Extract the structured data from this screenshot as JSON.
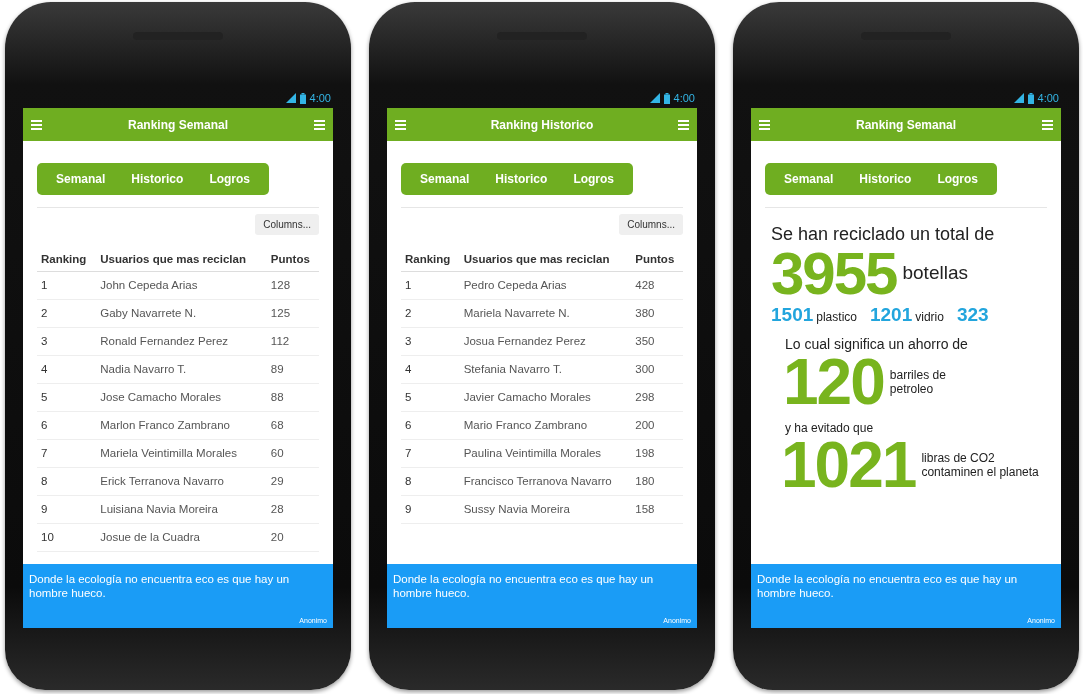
{
  "phones": [
    {
      "status": {
        "time": "4:00"
      },
      "title": "Ranking Semanal",
      "tabs": [
        "Semanal",
        "Historico",
        "Logros"
      ],
      "content": {
        "kind": "table",
        "columns_button": "Columns...",
        "columns": [
          "Ranking",
          "Usuarios que mas reciclan",
          "Puntos"
        ],
        "rows": [
          [
            "1",
            "John Cepeda Arias",
            "128"
          ],
          [
            "2",
            "Gaby Navarrete N.",
            "125"
          ],
          [
            "3",
            "Ronald Fernandez Perez",
            "112"
          ],
          [
            "4",
            "Nadia Navarro T.",
            "89"
          ],
          [
            "5",
            "Jose Camacho Morales",
            "88"
          ],
          [
            "6",
            "Marlon Franco Zambrano",
            "68"
          ],
          [
            "7",
            "Mariela Veintimilla Morales",
            "60"
          ],
          [
            "8",
            "Erick Terranova Navarro",
            "29"
          ],
          [
            "9",
            "Luisiana Navia Moreira",
            "28"
          ],
          [
            "10",
            "Josue de la Cuadra",
            "20"
          ]
        ]
      },
      "footer": {
        "quote": "Donde la ecología no encuentra eco es que hay un hombre hueco.",
        "author": "Anonimo"
      }
    },
    {
      "status": {
        "time": "4:00"
      },
      "title": "Ranking Historico",
      "tabs": [
        "Semanal",
        "Historico",
        "Logros"
      ],
      "content": {
        "kind": "table",
        "columns_button": "Columns...",
        "columns": [
          "Ranking",
          "Usuarios que mas reciclan",
          "Puntos"
        ],
        "rows": [
          [
            "1",
            "Pedro Cepeda Arias",
            "428"
          ],
          [
            "2",
            "Mariela Navarrete N.",
            "380"
          ],
          [
            "3",
            "Josua Fernandez Perez",
            "350"
          ],
          [
            "4",
            "Stefania Navarro T.",
            "300"
          ],
          [
            "5",
            "Javier Camacho Morales",
            "298"
          ],
          [
            "6",
            "Mario Franco Zambrano",
            "200"
          ],
          [
            "7",
            "Paulina Veintimilla Morales",
            "198"
          ],
          [
            "8",
            "Francisco Terranova Navarro",
            "180"
          ],
          [
            "9",
            "Sussy Navia Moreira",
            "158"
          ]
        ]
      },
      "footer": {
        "quote": "Donde la ecología no encuentra eco es que hay un hombre hueco.",
        "author": "Anonimo"
      }
    },
    {
      "status": {
        "time": "4:00"
      },
      "title": "Ranking Semanal",
      "tabs": [
        "Semanal",
        "Historico",
        "Logros"
      ],
      "content": {
        "kind": "stats",
        "total_label": "Se han reciclado un total de",
        "total": {
          "value": "3955",
          "unit": "botellas"
        },
        "breakdown": [
          {
            "kind": "count",
            "text": "1501"
          },
          {
            "kind": "label",
            "text": "plastico"
          },
          {
            "kind": "count",
            "text": "1201"
          },
          {
            "kind": "label",
            "text": "vidrio"
          },
          {
            "kind": "count",
            "text": "323"
          }
        ],
        "savings_label": "Lo cual significa un ahorro de",
        "savings": {
          "value": "120",
          "unit": "barriles de petroleo"
        },
        "avoided_label": "y ha evitado que",
        "avoided": {
          "value": "1021",
          "unit": "libras de CO2 contaminen el planeta"
        }
      },
      "footer": {
        "quote": "Donde la ecología no encuentra eco es que hay un hombre hueco.",
        "author": "Anonimo"
      }
    }
  ]
}
